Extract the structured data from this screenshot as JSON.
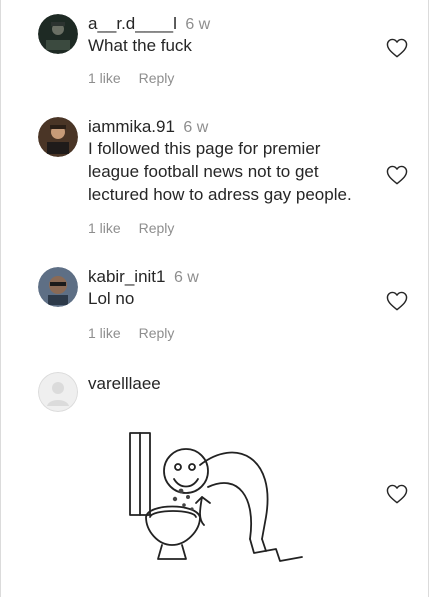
{
  "comments": [
    {
      "username": "a__r.d____l",
      "time": "6 w",
      "text": "What the fuck",
      "likes": "1 like",
      "reply": "Reply"
    },
    {
      "username": "iammika.91",
      "time": "6 w",
      "text": "I followed this page for premier league football news not to get lectured how to adress gay people.",
      "likes": "1 like",
      "reply": "Reply"
    },
    {
      "username": "kabir_init1",
      "time": "6 w",
      "text": "Lol no",
      "likes": "1 like",
      "reply": "Reply"
    },
    {
      "username": "varelllaee"
    }
  ],
  "colors": {
    "text": "#262626",
    "muted": "#8e8e8e",
    "border": "#dbdbdb"
  },
  "icons": [
    "heart-icon"
  ]
}
